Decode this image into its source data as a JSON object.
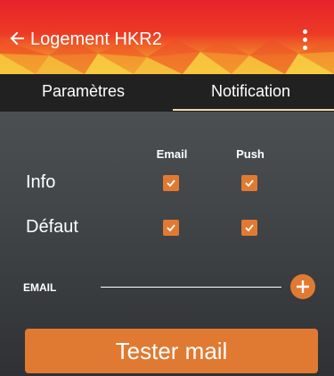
{
  "header": {
    "title": "Logement HKR2",
    "back_icon": "arrow-left-icon",
    "menu_icon": "more-vertical-icon",
    "gradient_top": "#e8222b",
    "gradient_bottom": "#f6c43a"
  },
  "tabs": [
    {
      "label": "Paramètres",
      "selected": false
    },
    {
      "label": "Notification",
      "selected": true
    }
  ],
  "notifications": {
    "columns": [
      "Email",
      "Push"
    ],
    "rows": [
      {
        "label": "Info",
        "email": true,
        "push": true
      },
      {
        "label": "Défaut",
        "email": true,
        "push": true
      }
    ]
  },
  "email": {
    "label": "EMAIL",
    "value": "",
    "add_icon": "plus-circle-icon"
  },
  "test_button": {
    "label": "Tester mail"
  },
  "colors": {
    "accent": "#e07a32",
    "tab_bar": "#212121",
    "tab_indicator": "#f6d9a9"
  }
}
